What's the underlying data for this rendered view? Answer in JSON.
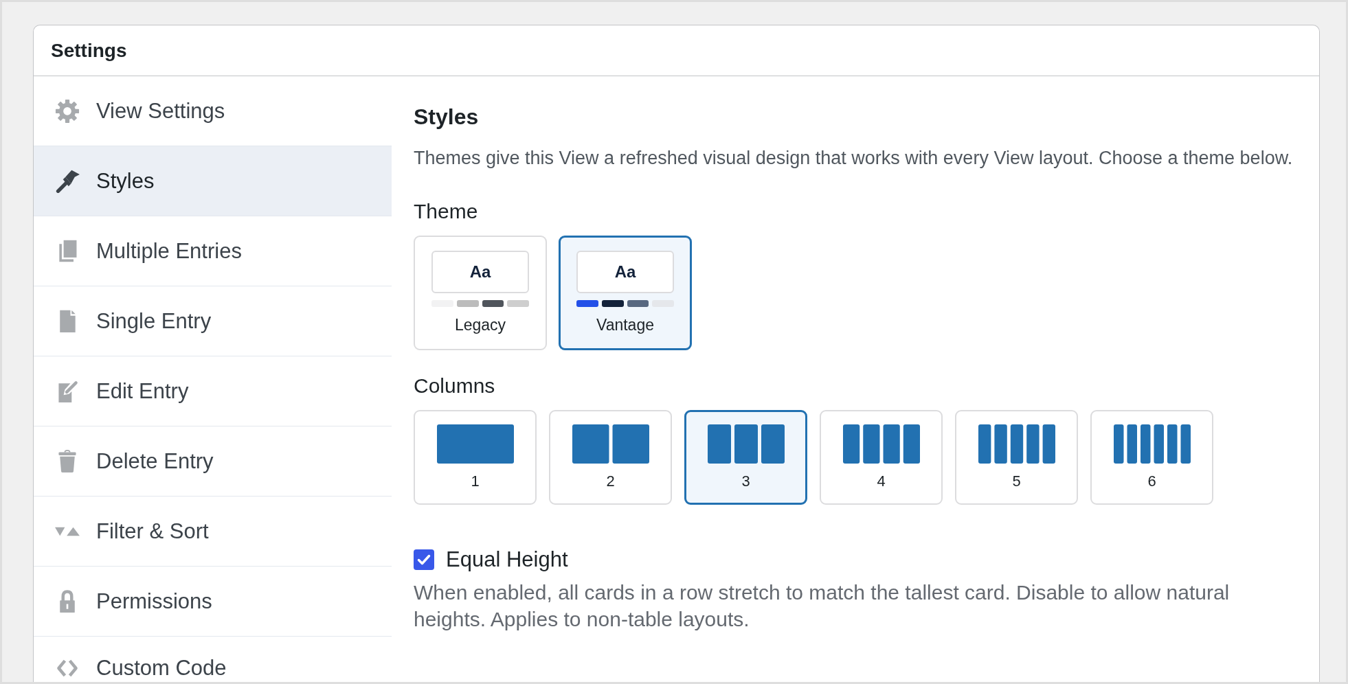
{
  "panel": {
    "title": "Settings"
  },
  "sidebar": {
    "items": [
      {
        "label": "View Settings",
        "selected": false
      },
      {
        "label": "Styles",
        "selected": true
      },
      {
        "label": "Multiple Entries",
        "selected": false
      },
      {
        "label": "Single Entry",
        "selected": false
      },
      {
        "label": "Edit Entry",
        "selected": false
      },
      {
        "label": "Delete Entry",
        "selected": false
      },
      {
        "label": "Filter & Sort",
        "selected": false
      },
      {
        "label": "Permissions",
        "selected": false
      },
      {
        "label": "Custom Code",
        "selected": false
      }
    ]
  },
  "content": {
    "heading": "Styles",
    "description": "Themes give this View a refreshed visual design that works with every View layout. Choose a theme below.",
    "theme": {
      "label": "Theme",
      "options": [
        {
          "sample": "Aa",
          "name": "Legacy",
          "selected": false,
          "swatches": [
            {
              "color": "#f2f2f3"
            },
            {
              "color": "#bcbcbc"
            },
            {
              "color": "#50555c"
            },
            {
              "color": "#cecece"
            }
          ]
        },
        {
          "sample": "Aa",
          "name": "Vantage",
          "selected": true,
          "swatches": [
            {
              "color": "#2350e8"
            },
            {
              "color": "#13223a"
            },
            {
              "color": "#586880"
            },
            {
              "color": "#e5e7eb"
            }
          ]
        }
      ]
    },
    "columns": {
      "label": "Columns",
      "options": [
        {
          "label": "1",
          "selected": false
        },
        {
          "label": "2",
          "selected": false
        },
        {
          "label": "3",
          "selected": true
        },
        {
          "label": "4",
          "selected": false
        },
        {
          "label": "5",
          "selected": false
        },
        {
          "label": "6",
          "selected": false
        }
      ]
    },
    "equal_height": {
      "label": "Equal Height",
      "checked": true,
      "description": "When enabled, all cards in a row stretch to match the tallest card. Disable to allow natural heights. Applies to non-table layouts."
    }
  }
}
